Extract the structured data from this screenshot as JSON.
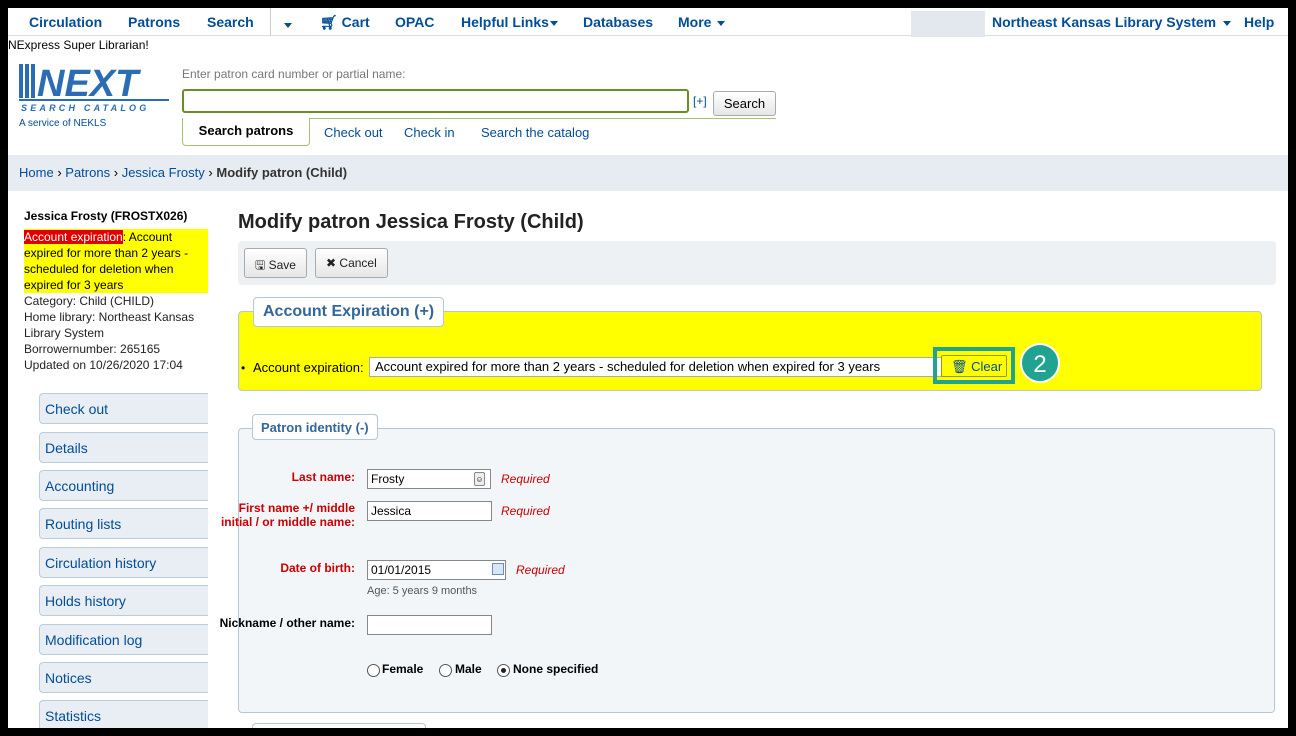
{
  "nav": {
    "circulation": "Circulation",
    "patrons": "Patrons",
    "search": "Search",
    "cart": "Cart",
    "opac": "OPAC",
    "helpful_links": "Helpful Links",
    "databases": "Databases",
    "more": "More",
    "library": "Northeast Kansas Library System",
    "help": "Help"
  },
  "welcome": "NExpress Super Librarian!",
  "logo": {
    "main": "NEXT",
    "sub": "SEARCH CATALOG",
    "tagline": "A service of NEKLS"
  },
  "search": {
    "hint": "Enter patron card number or partial name:",
    "value": "",
    "expand": "[+]",
    "button": "Search",
    "tabs": [
      "Search patrons",
      "Check out",
      "Check in",
      "Search the catalog"
    ]
  },
  "breadcrumb": {
    "home": "Home",
    "patrons": "Patrons",
    "patron": "Jessica Frosty",
    "current": "Modify patron (Child)",
    "sep": "›"
  },
  "patron_info": {
    "name": "Jessica Frosty (FROSTX026)",
    "exp_label": "Account expiration",
    "exp_text": ": Account expired for more than 2 years - scheduled for deletion when expired for 3 years",
    "category": "Category: Child (CHILD)",
    "home_library": "Home library: Northeast Kansas Library System",
    "borrowernumber": "Borrowernumber: 265165",
    "updated": "Updated on 10/26/2020 17:04"
  },
  "left_menu": [
    "Check out",
    "Details",
    "Accounting",
    "Routing lists",
    "Circulation history",
    "Holds history",
    "Modification log",
    "Notices",
    "Statistics"
  ],
  "page_title": "Modify patron Jessica Frosty (Child)",
  "toolbar": {
    "save": "Save",
    "cancel": "Cancel"
  },
  "expiration": {
    "legend": "Account Expiration (+)",
    "label": "Account expiration:",
    "value": "Account expired for more than 2 years - scheduled for deletion when expired for 3 years",
    "clear": "Clear",
    "step": "2"
  },
  "identity": {
    "legend": "Patron identity (-)",
    "last_name_label": "Last name:",
    "last_name": "Frosty",
    "first_name_label": "First name +/ middle initial / or middle name:",
    "first_name": "Jessica",
    "dob_label": "Date of birth:",
    "dob": "01/01/2015",
    "age": "Age: 5 years 9 months",
    "nickname_label": "Nickname / other name:",
    "nickname": "",
    "required": "Required",
    "gender": {
      "female": "Female",
      "male": "Male",
      "none": "None specified",
      "selected": "none"
    }
  },
  "colors": {
    "link": "#004d99",
    "highlight": "#ffff00",
    "accent": "#20a391",
    "required": "#cc0000"
  }
}
